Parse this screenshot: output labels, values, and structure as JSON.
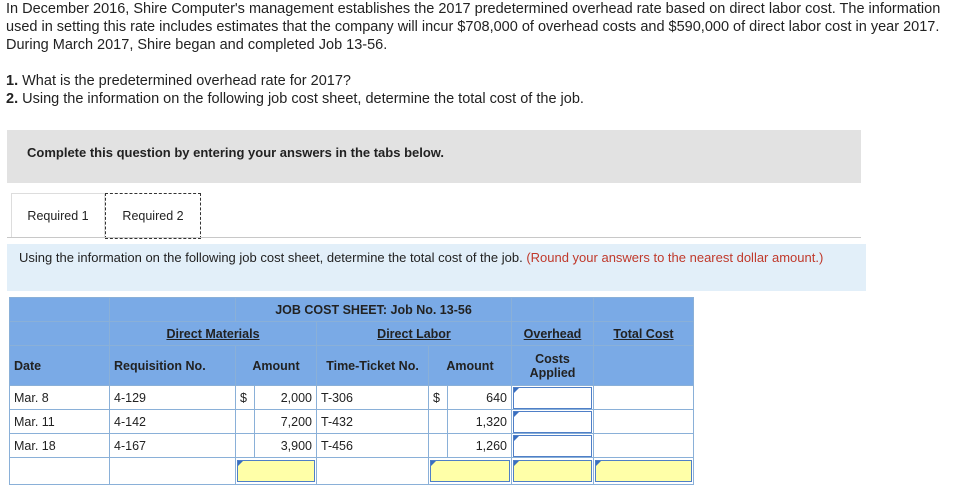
{
  "intro": "In December 2016, Shire Computer's management establishes the 2017 predetermined overhead rate based on direct labor cost. The information used in setting this rate includes estimates that the company will incur $708,000 of overhead costs and $590,000 of direct labor cost in year 2017. During March 2017, Shire began and completed Job 13-56.",
  "questions": [
    {
      "num": "1.",
      "text": "What is the predetermined overhead rate for 2017?"
    },
    {
      "num": "2.",
      "text": "Using the information on the following job cost sheet, determine the total cost of the job."
    }
  ],
  "complete_box": "Complete this question by entering your answers in the tabs below.",
  "tabs": [
    "Required 1",
    "Required 2"
  ],
  "instructions": {
    "text": "Using the information on the following job cost sheet, determine the total cost of the job.",
    "note": "(Round your answers to the nearest dollar amount.)"
  },
  "job_cost_sheet": {
    "title": "JOB COST SHEET: Job No. 13-56",
    "groups": {
      "direct_materials": "Direct Materials",
      "direct_labor": "Direct Labor",
      "overhead": "Overhead",
      "total_cost": "Total Cost"
    },
    "columns": {
      "date": "Date",
      "requisition": "Requisition No.",
      "amount": "Amount",
      "ticket": "Time-Ticket No.",
      "amount2": "Amount",
      "overhead_applied": "Costs Applied"
    },
    "rows": [
      {
        "date": "Mar. 8",
        "req": "4-129",
        "dollar": "$",
        "dm_amount": "2,000",
        "ticket": "T-306",
        "dollar2": "$",
        "dl_amount": "640",
        "overhead": ""
      },
      {
        "date": "Mar. 11",
        "req": "4-142",
        "dollar": "",
        "dm_amount": "7,200",
        "ticket": "T-432",
        "dollar2": "",
        "dl_amount": "1,320",
        "overhead": ""
      },
      {
        "date": "Mar. 18",
        "req": "4-167",
        "dollar": "",
        "dm_amount": "3,900",
        "ticket": "T-456",
        "dollar2": "",
        "dl_amount": "1,260",
        "overhead": ""
      }
    ],
    "totals": {
      "dm_total": "",
      "dl_total": "",
      "overhead_total": "",
      "total_cost": ""
    }
  }
}
